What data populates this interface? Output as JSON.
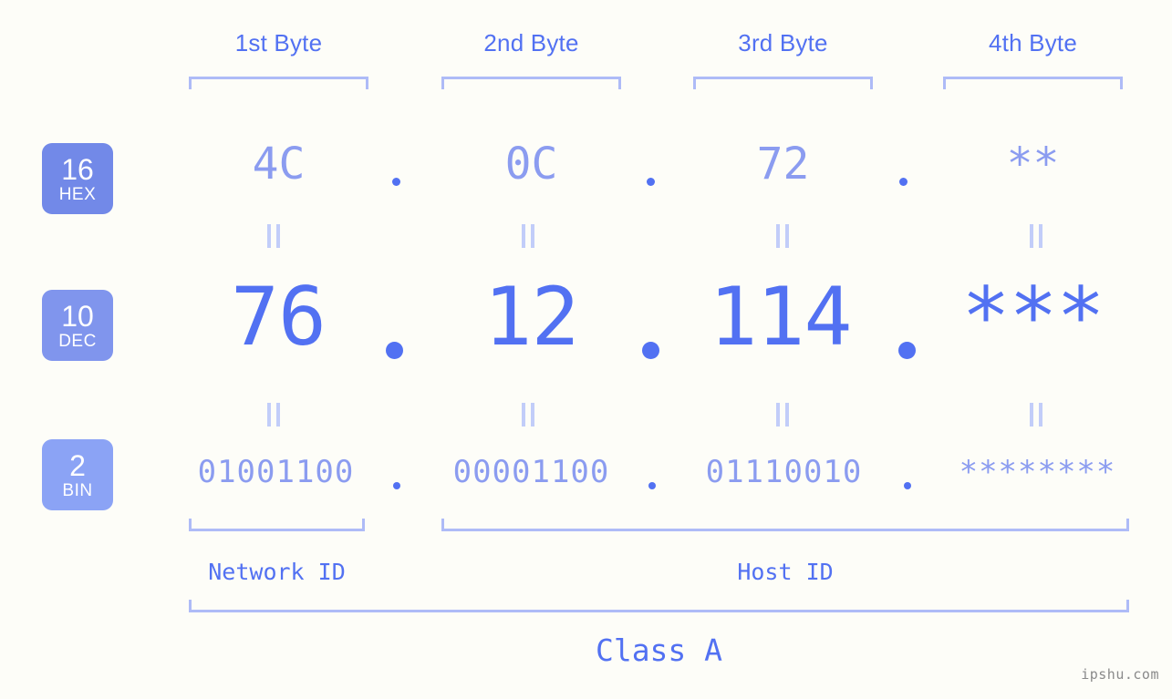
{
  "background_color": "#fdfdf8",
  "accent_strong": "#5271f2",
  "accent_mid": "#8b9cf0",
  "accent_light": "#aebbf7",
  "headers": [
    {
      "label": "1st Byte"
    },
    {
      "label": "2nd Byte"
    },
    {
      "label": "3rd Byte"
    },
    {
      "label": "4th Byte"
    }
  ],
  "bases": [
    {
      "number": "16",
      "name": "HEX",
      "color": "#7289e8"
    },
    {
      "number": "10",
      "name": "DEC",
      "color": "#8095ed"
    },
    {
      "number": "2",
      "name": "BIN",
      "color": "#8ba3f5"
    }
  ],
  "rows": {
    "hex": {
      "base": "16",
      "base_name": "HEX",
      "values": [
        "4C",
        "0C",
        "72",
        "**"
      ],
      "separator": "."
    },
    "dec": {
      "base": "10",
      "base_name": "DEC",
      "values": [
        "76",
        "12",
        "114",
        "***"
      ],
      "separator": "."
    },
    "bin": {
      "base": "2",
      "base_name": "BIN",
      "values": [
        "01001100",
        "00001100",
        "01110010",
        "********"
      ],
      "separator": "."
    }
  },
  "equality_symbol": "||",
  "segments": {
    "network_id": "Network ID",
    "host_id": "Host ID"
  },
  "class": "Class A",
  "watermark": "ipshu.com"
}
